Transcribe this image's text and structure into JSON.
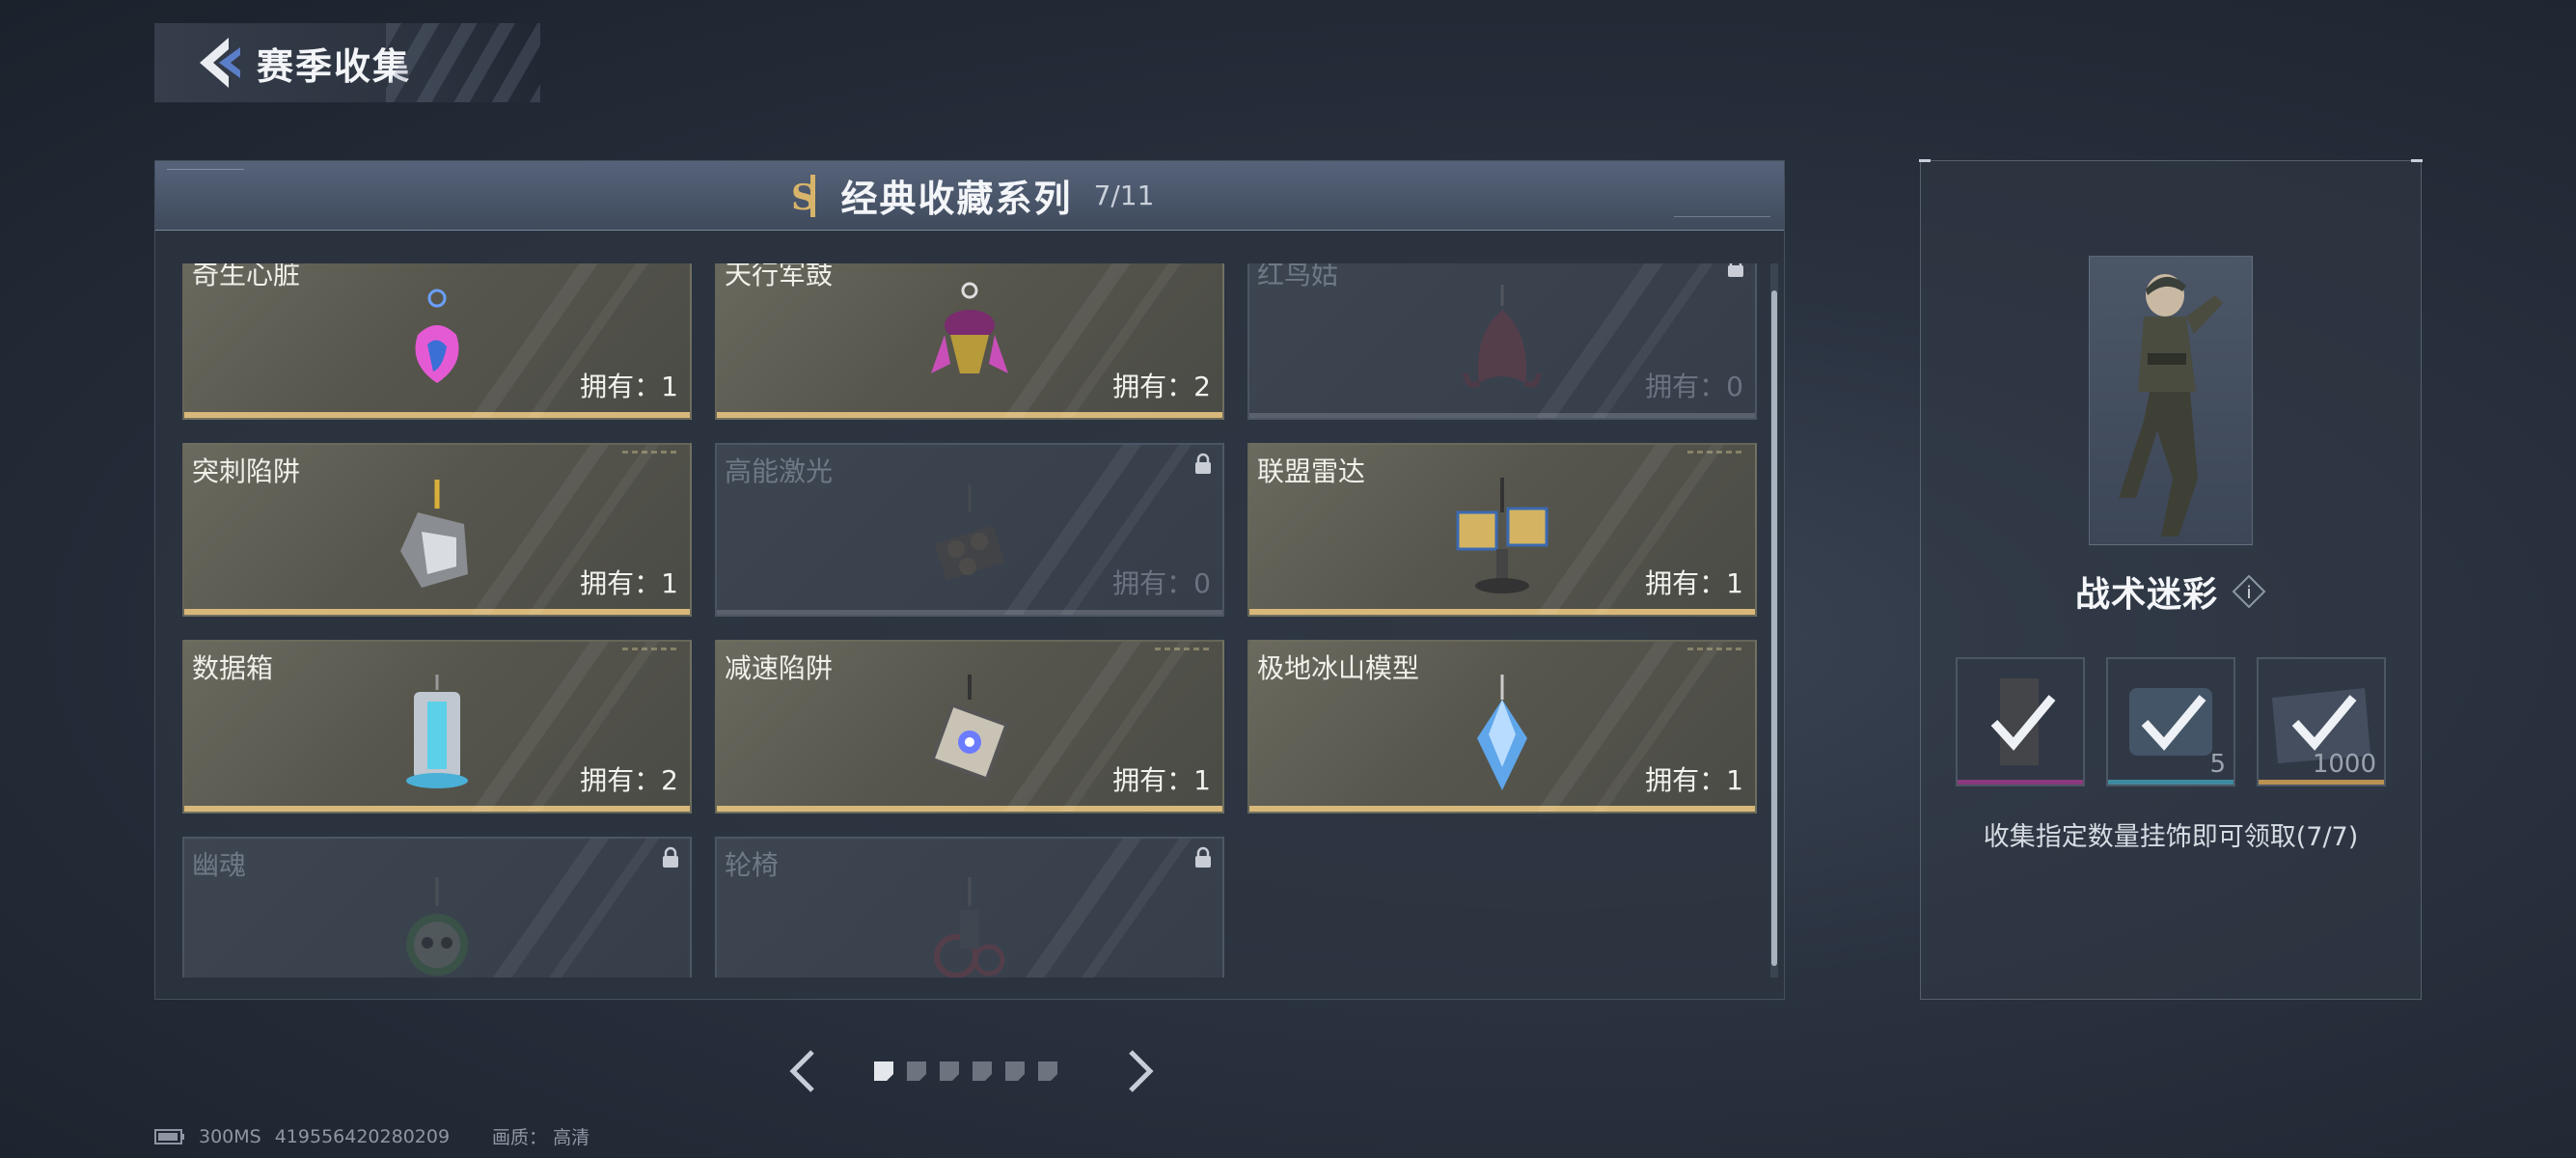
{
  "header": {
    "title": "赛季收集",
    "back_icon": "back-chevron-icon"
  },
  "series": {
    "logo_text": "SI",
    "title": "经典收藏系列",
    "count": "7/11"
  },
  "items": [
    {
      "name": "奇生心脏",
      "owned": "拥有：1",
      "locked": false,
      "icon": "pink-heart-charm-icon"
    },
    {
      "name": "天行军鼓",
      "owned": "拥有：2",
      "locked": false,
      "icon": "war-drum-charm-icon"
    },
    {
      "name": "红鸟姑",
      "owned": "拥有：0",
      "locked": true,
      "icon": "red-bird-charm-icon"
    },
    {
      "name": "突刺陷阱",
      "owned": "拥有：1",
      "locked": false,
      "icon": "spike-trap-charm-icon"
    },
    {
      "name": "高能激光",
      "owned": "拥有：0",
      "locked": true,
      "icon": "laser-charm-icon"
    },
    {
      "name": "联盟雷达",
      "owned": "拥有：1",
      "locked": false,
      "icon": "radar-charm-icon"
    },
    {
      "name": "数据箱",
      "owned": "拥有：2",
      "locked": false,
      "icon": "data-box-charm-icon"
    },
    {
      "name": "减速陷阱",
      "owned": "拥有：1",
      "locked": false,
      "icon": "slow-trap-charm-icon"
    },
    {
      "name": "极地冰山模型",
      "owned": "拥有：1",
      "locked": false,
      "icon": "iceberg-charm-icon"
    },
    {
      "name": "幽魂",
      "owned": "",
      "locked": true,
      "icon": "ghost-skull-charm-icon"
    },
    {
      "name": "轮椅",
      "owned": "",
      "locked": true,
      "icon": "wheelchair-charm-icon"
    }
  ],
  "pager": {
    "pages": 6,
    "current": 1
  },
  "reward_panel": {
    "skin_name": "战术迷彩",
    "info_label": "i",
    "rewards": [
      {
        "icon": "skin-reward-icon",
        "qty": "",
        "claimed": true,
        "color": "#8a3a7c"
      },
      {
        "icon": "crate-reward-icon",
        "qty": "5",
        "claimed": true,
        "color": "#3f8aa0"
      },
      {
        "icon": "coupon-reward-icon",
        "qty": "1000",
        "claimed": true,
        "color": "#b89252"
      }
    ],
    "collect_text": "收集指定数量挂饰即可领取(7/7)"
  },
  "status_bar": {
    "latency": "300MS",
    "uid": "419556420280209",
    "quality": "画质：  高清"
  },
  "colors": {
    "owned_bar": "#d8b87a",
    "locked_bar": "#5a616c",
    "accent_blue": "#5b7ec8"
  }
}
